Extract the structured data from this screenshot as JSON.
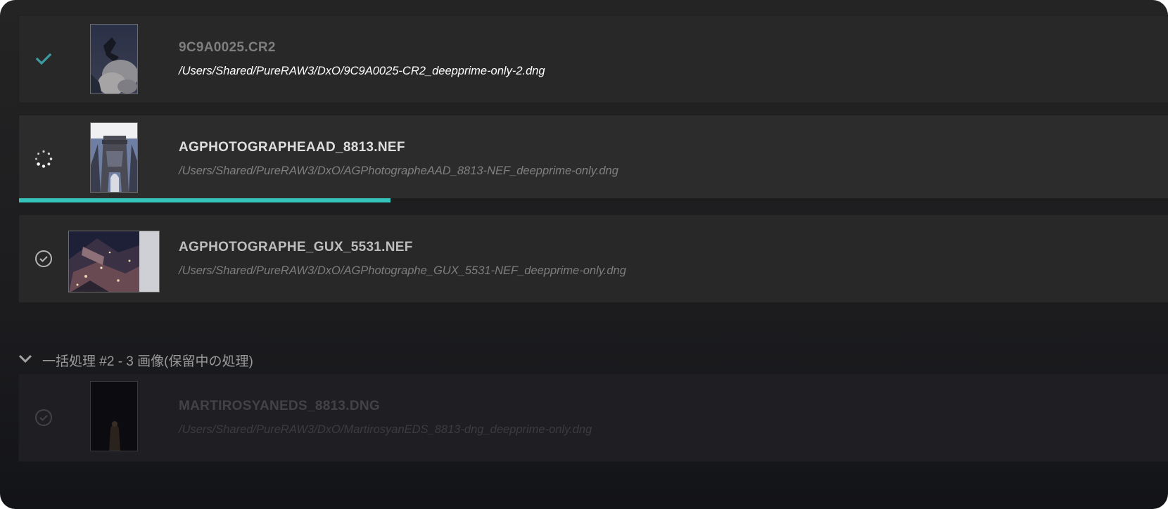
{
  "queue": {
    "items": [
      {
        "status": "done",
        "status_icon": "checkmark-icon",
        "filename": "9C9A0025.CR2",
        "path": "/Users/Shared/PureRAW3/DxO/9C9A0025-CR2_deepprime-only-2.dng"
      },
      {
        "status": "processing",
        "status_icon": "spinner-icon",
        "filename": "AGPHOTOGRAPHEAAD_8813.NEF",
        "path": "/Users/Shared/PureRAW3/DxO/AGPhotographeAAD_8813-NEF_deepprime-only.dng",
        "progress": 0.32
      },
      {
        "status": "queued",
        "status_icon": "circle-check-icon",
        "filename": "AGPHOTOGRAPHE_GUX_5531.NEF",
        "path": "/Users/Shared/PureRAW3/DxO/AGPhotographe_GUX_5531-NEF_deepprime-only.dng"
      }
    ],
    "group2": {
      "header": "一括処理 #2 - 3 画像(保留中の処理)",
      "items": [
        {
          "status": "pending",
          "status_icon": "circle-check-icon",
          "filename": "MARTIROSYANEDS_8813.DNG",
          "path": "/Users/Shared/PureRAW3/DxO/MartirosyanEDS_8813-dng_deepprime-only.dng"
        }
      ]
    }
  },
  "colors": {
    "accent": "#35c4bb",
    "done_check": "#3d9aa0"
  }
}
